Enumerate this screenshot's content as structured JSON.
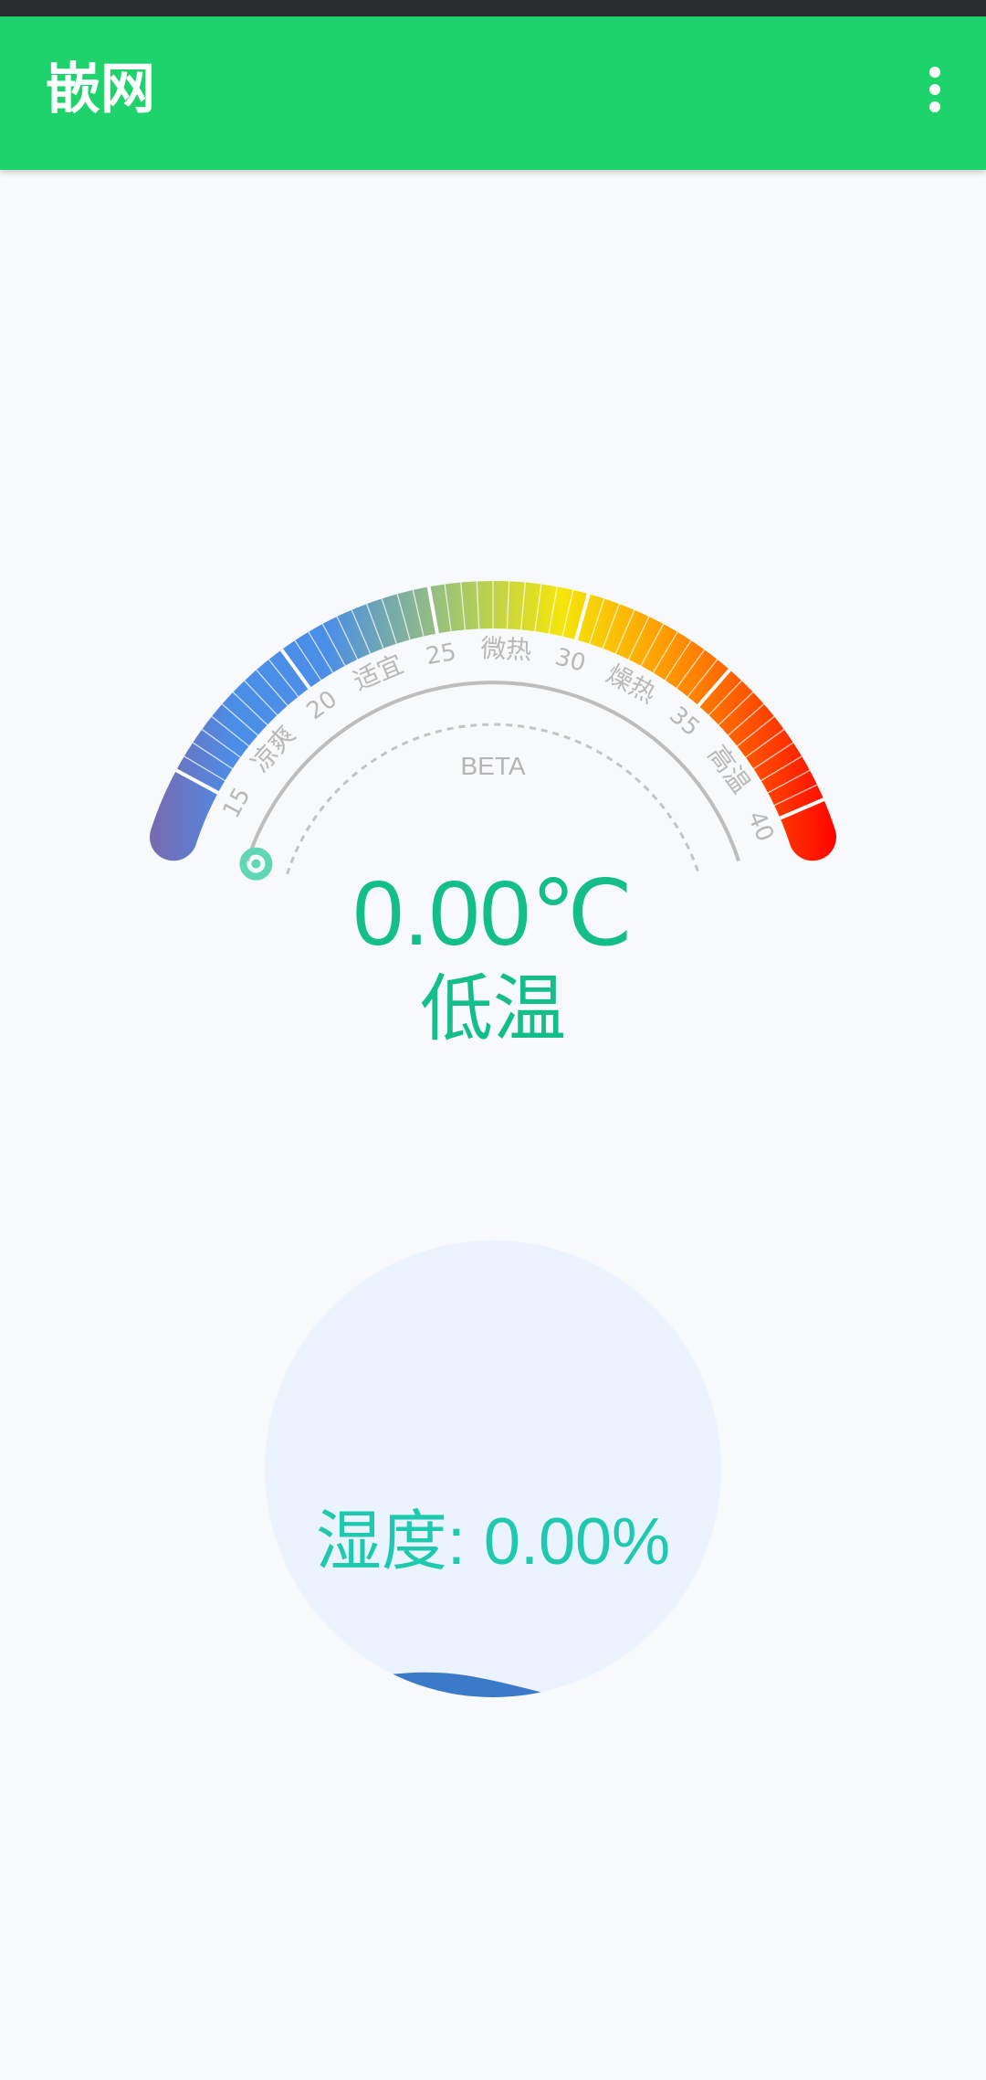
{
  "app_bar": {
    "title": "嵌网",
    "menu_icon": "more-vert-icon",
    "background": "#1ed36c"
  },
  "gauge": {
    "min": 13,
    "max": 41,
    "current_value": 0.0,
    "tick_labels": [
      "15",
      "20",
      "25",
      "30",
      "35",
      "40"
    ],
    "zone_labels": [
      {
        "text": "凉爽",
        "value": 17.5
      },
      {
        "text": "适宜",
        "value": 22.5
      },
      {
        "text": "微热",
        "value": 27.5
      },
      {
        "text": "燥热",
        "value": 32.5
      },
      {
        "text": "高温",
        "value": 37.5
      }
    ],
    "beta_label": "BETA",
    "pointer_icon": "pointer-icon",
    "colors": {
      "start": "#7b68ae",
      "blue": "#4a8ee8",
      "yellow": "#f5e60a",
      "orange": "#ff9a00",
      "end": "#ff0000",
      "labels": "#b8b8b8",
      "accent": "#13bf87"
    }
  },
  "temperature": {
    "value_text": "0.00℃",
    "status_text": "低温"
  },
  "humidity": {
    "label_text": "湿度: 0.00%",
    "value_percent": 0.0,
    "circle_color": "#ebf3fe",
    "wave_color": "#3b7ac8"
  }
}
